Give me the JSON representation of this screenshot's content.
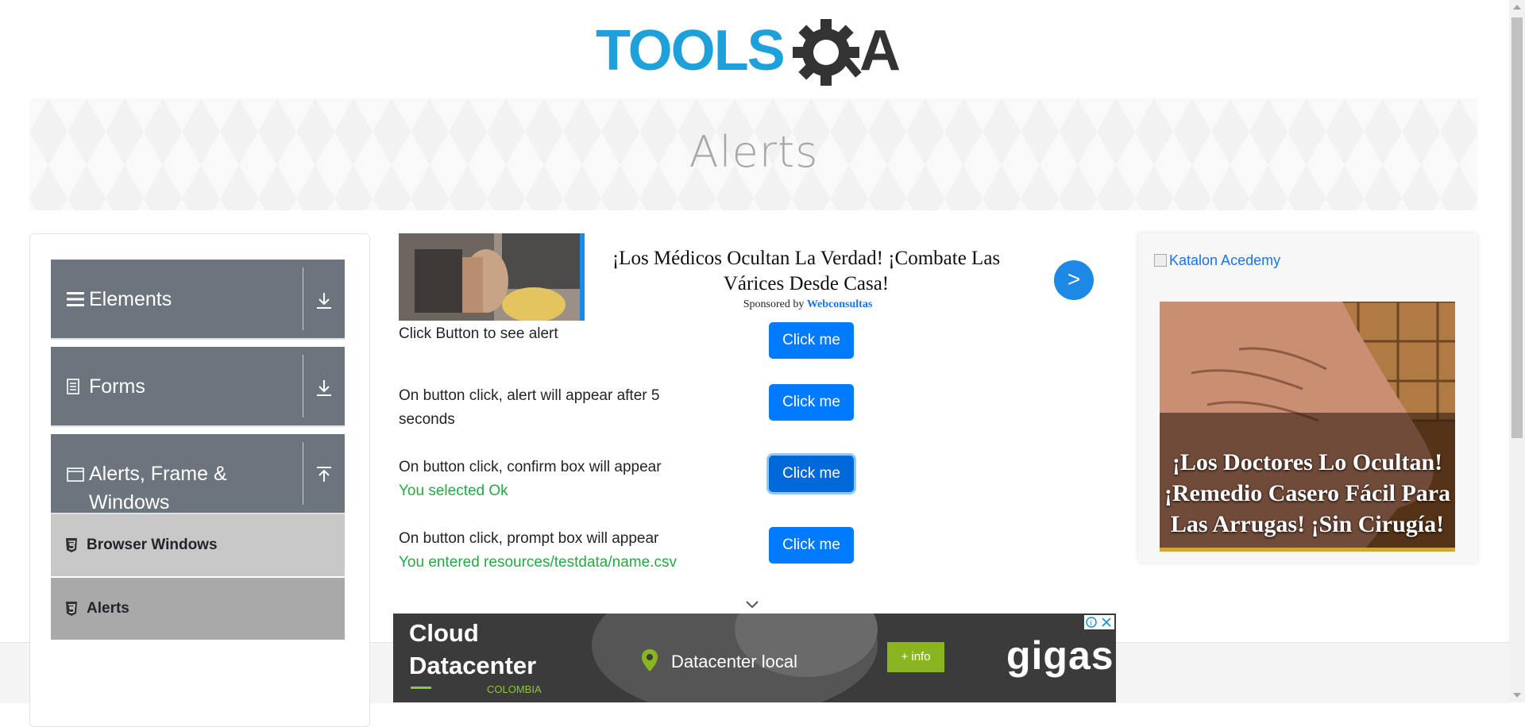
{
  "header": {
    "logo_text_left": "TOOLS",
    "logo_text_right": "A"
  },
  "banner": {
    "title": "Alerts"
  },
  "sidebar": {
    "groups": [
      {
        "label": "Elements",
        "icon": "hamburger-icon",
        "state": "collapsed"
      },
      {
        "label": "Forms",
        "icon": "document-icon",
        "state": "collapsed"
      },
      {
        "label": "Alerts, Frame & Windows",
        "icon": "window-icon",
        "state": "expanded"
      }
    ],
    "items": [
      {
        "label": "Browser Windows",
        "icon": "html5-icon",
        "active": false
      },
      {
        "label": "Alerts",
        "icon": "html5-icon",
        "active": true
      }
    ]
  },
  "ad_top": {
    "title": "¡Los Médicos Ocultan La Verdad! ¡Combate Las Várices Desde Casa!",
    "sponsored_by": "Sponsored by",
    "sponsor": "Webconsultas",
    "go": ">"
  },
  "alerts": [
    {
      "text": "Click Button to see alert",
      "result": "",
      "button": "Click me",
      "focused": false
    },
    {
      "text": "On button click, alert will appear after 5 seconds",
      "result": "",
      "button": "Click me",
      "focused": false
    },
    {
      "text": "On button click, confirm box will appear",
      "result": "You selected Ok",
      "button": "Click me",
      "focused": true
    },
    {
      "text": "On button click, prompt box will appear",
      "result": "You entered resources/testdata/name.csv",
      "button": "Click me",
      "focused": false
    }
  ],
  "right_ad": {
    "broken_image_alt": "Katalon Acedemy",
    "headline": "¡Los Doctores Lo Ocultan! ¡Remedio Casero Fácil Para Las Arrugas! ¡Sin Cirugía!"
  },
  "bottom_ad": {
    "title": "Cloud Datacenter",
    "country": "COLOMBIA",
    "location": "Datacenter local",
    "info_button": "+ info",
    "brand": "gigas"
  },
  "colors": {
    "primary": "#007bff",
    "sidebar_group": "#6c757d",
    "result_text": "#28a745",
    "logo_blue": "#1ea1db",
    "logo_dark": "#333333"
  }
}
